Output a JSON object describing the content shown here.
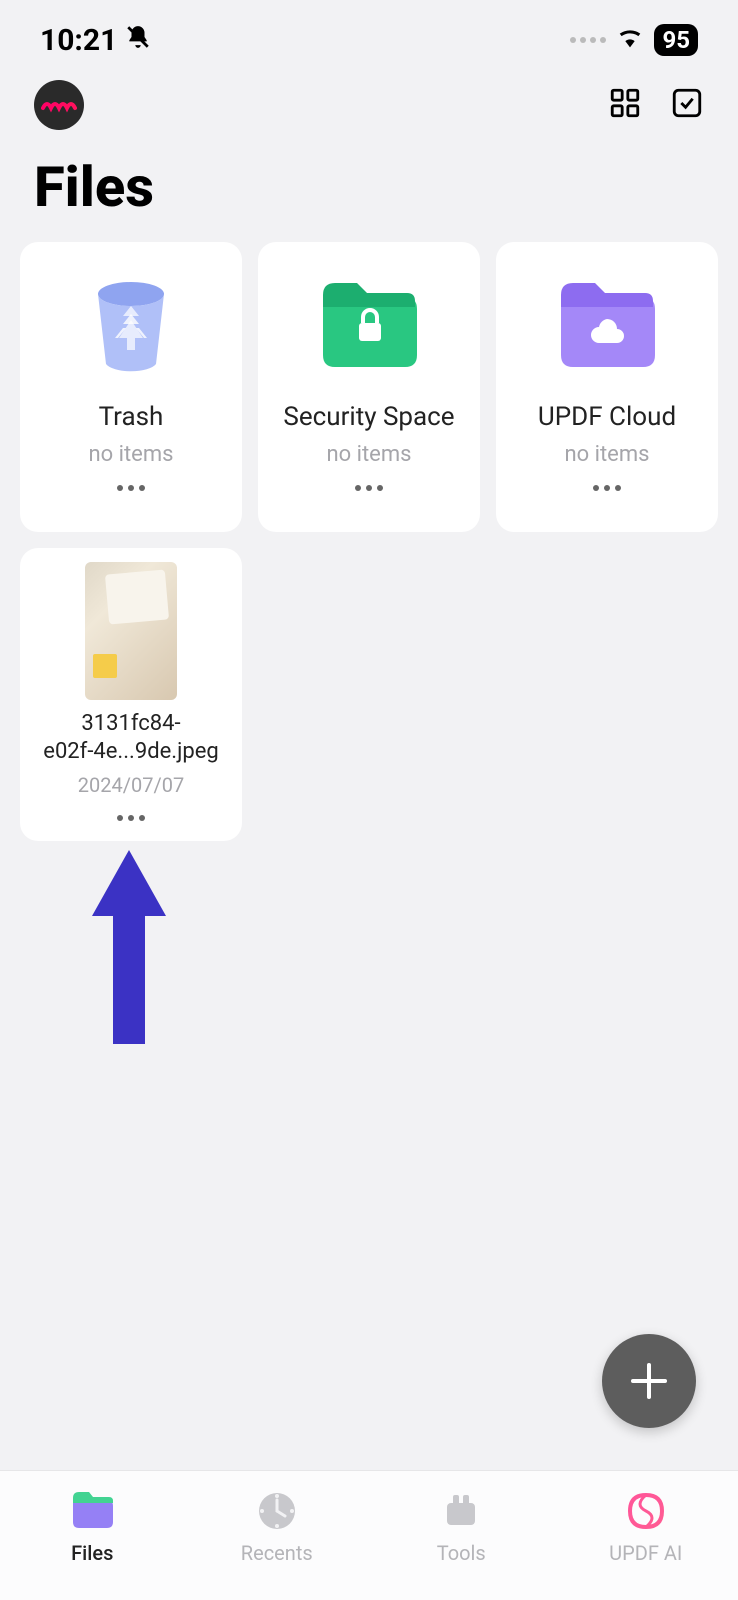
{
  "status_bar": {
    "time": "10:21",
    "battery": "95"
  },
  "page": {
    "title": "Files"
  },
  "cards": {
    "trash": {
      "title": "Trash",
      "subtitle": "no items"
    },
    "security": {
      "title": "Security Space",
      "subtitle": "no items"
    },
    "cloud": {
      "title": "UPDF Cloud",
      "subtitle": "no items"
    },
    "file1": {
      "title_line1": "3131fc84-",
      "title_line2": "e02f-4e...9de.jpeg",
      "date": "2024/07/07"
    }
  },
  "tabs": {
    "files": "Files",
    "recents": "Recents",
    "tools": "Tools",
    "ai": "UPDF AI"
  }
}
